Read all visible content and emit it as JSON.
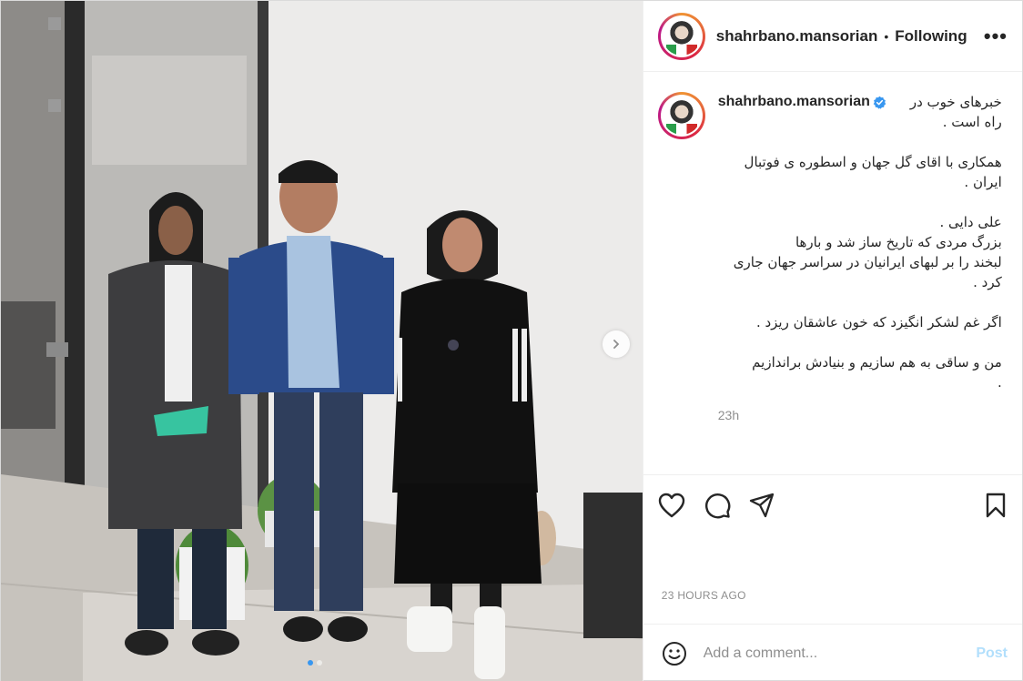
{
  "post": {
    "username": "shahrbano.mansorian",
    "separator": "•",
    "follow_status": "Following",
    "more_label": "•••",
    "caption": {
      "first_line": "خبرهای خوب در",
      "lines": [
        "راه است .",
        "",
        "همکاری با اقای گل جهان و اسطوره ی فوتبال",
        "ایران .",
        "",
        "علی دایی .",
        "بزرگ مردی که تاریخ ساز شد و بارها",
        "لبخند را بر لبهای ایرانیان در سراسر جهان جاری",
        "کرد .",
        "",
        "اگر غم لشکر انگیزد که خون عاشقان ریزد .",
        "",
        "من و ساقی به هم سازیم و بنیادش براندازیم",
        "."
      ]
    },
    "caption_time": "23h",
    "timestamp": "23 HOURS AGO",
    "comment_placeholder": "Add a comment...",
    "post_button": "Post",
    "carousel": {
      "total": 2,
      "active_index": 0
    }
  },
  "icons": {
    "like": "heart-icon",
    "comment": "comment-icon",
    "share": "share-icon",
    "save": "bookmark-icon",
    "emoji": "emoji-icon",
    "next": "chevron-right-icon",
    "verified": "verified-badge-icon"
  },
  "colors": {
    "link_blue": "#3897f0",
    "post_button_disabled": "#b2dffc",
    "muted_text": "#8e8e8e",
    "verified": "#3897f0"
  }
}
